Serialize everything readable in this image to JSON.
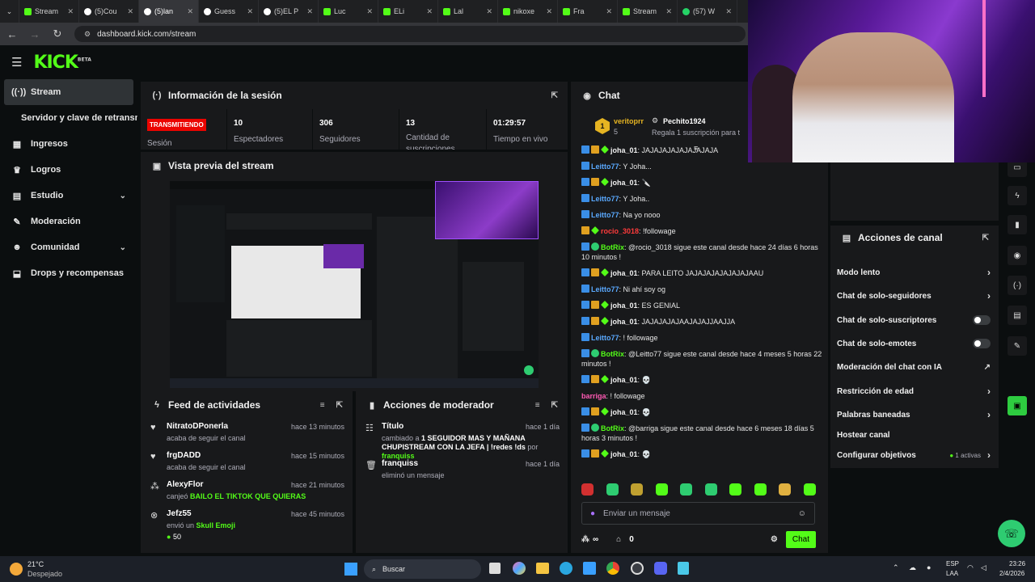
{
  "browser": {
    "tabs": [
      {
        "title": "Stream",
        "icon": "kick-favicon"
      },
      {
        "title": "(5)Cou",
        "icon": "tiktok-favicon"
      },
      {
        "title": "(5)lan",
        "icon": "tiktok-favicon",
        "active": true
      },
      {
        "title": "Guess",
        "icon": "tiktok-favicon"
      },
      {
        "title": "(5)EL P",
        "icon": "tiktok-favicon"
      },
      {
        "title": "Luc",
        "icon": "kick-favicon"
      },
      {
        "title": "ELi",
        "icon": "kick-favicon"
      },
      {
        "title": "Lal",
        "icon": "kick-favicon"
      },
      {
        "title": "nikoxe",
        "icon": "kick-favicon"
      },
      {
        "title": "Fra",
        "icon": "kick-favicon"
      },
      {
        "title": "Stream",
        "icon": "kick-favicon"
      },
      {
        "title": "(57) W",
        "icon": "whatsapp-favicon"
      }
    ],
    "url": "dashboard.kick.com/stream"
  },
  "header": {
    "logo": "KICK",
    "logo_tag": "BETA"
  },
  "sidebar": {
    "items": [
      {
        "label": "Stream",
        "icon": "broadcast-icon"
      },
      {
        "label": "Servidor y clave de retransm",
        "icon": ""
      },
      {
        "label": "Ingresos",
        "icon": "income-icon"
      },
      {
        "label": "Logros",
        "icon": "trophy-icon"
      },
      {
        "label": "Estudio",
        "icon": "studio-icon"
      },
      {
        "label": "Moderación",
        "icon": "wrench-icon"
      },
      {
        "label": "Comunidad",
        "icon": "community-icon"
      },
      {
        "label": "Drops y recompensas",
        "icon": "drops-icon"
      }
    ]
  },
  "session": {
    "title": "Información de la sesión",
    "status_badge": "TRANSMITIENDO",
    "status_label": "Sesión",
    "stats": [
      {
        "value": "10",
        "label": "Espectadores"
      },
      {
        "value": "306",
        "label": "Seguidores"
      },
      {
        "value": "13",
        "label": "Cantidad de suscripciones"
      },
      {
        "value": "01:29:57",
        "label": "Tiempo en vivo"
      }
    ]
  },
  "preview": {
    "title": "Vista previa del stream"
  },
  "feed": {
    "title": "Feed de actividades",
    "items": [
      {
        "name": "NitratoDPonerla",
        "desc": "acaba de seguir el canal",
        "time": "hace 13 minutos",
        "icon": "heart-icon"
      },
      {
        "name": "frgDADD",
        "desc": "acaba de seguir el canal",
        "time": "hace 15 minutos",
        "icon": "heart-icon"
      },
      {
        "name": "AlexyFlor",
        "desc_pre": "canjeó",
        "desc_hl": "BAILO EL TIKTOK QUE QUIERAS",
        "time": "hace 21 minutos",
        "icon": "redeem-icon"
      },
      {
        "name": "Jefz55",
        "desc_pre": "envió un",
        "desc_hl": "Skull Emoji",
        "amount": "50",
        "time": "hace 45 minutos",
        "icon": "kicks-icon"
      }
    ]
  },
  "mod_actions": {
    "title": "Acciones de moderador",
    "items": [
      {
        "name": "Título",
        "desc_pre": "cambiado a",
        "desc_hl": "1 SEGUIDOR MAS Y MAÑANA CHUPISTREAM CON LA JEFA | !redes !ds",
        "desc_post": "por",
        "by": "franquiss",
        "time": "hace 1 día"
      },
      {
        "name": "franquiss",
        "desc": "eliminó un mensaje",
        "time": "hace 1 día"
      }
    ]
  },
  "chat": {
    "title": "Chat",
    "pinned": {
      "rank": "1",
      "user": "veritoprr",
      "count": "5",
      "gifter": "Pechito1924",
      "gift_text": "Regala 1 suscripción para t"
    },
    "messages": [
      {
        "user": "joha_01",
        "color": "#f0f0f0",
        "text": "JAJAJAJAJAJAJAJAJA",
        "badges": [
          "b",
          "c",
          "g"
        ]
      },
      {
        "user": "Leitto77",
        "color": "#5aa9ff",
        "text": "Y Joha...",
        "badges": [
          "b"
        ]
      },
      {
        "user": "joha_01",
        "color": "#f0f0f0",
        "text": "🔪",
        "badges": [
          "b",
          "c",
          "g"
        ]
      },
      {
        "user": "Leitto77",
        "color": "#5aa9ff",
        "text": "Y Joha..",
        "badges": [
          "b"
        ]
      },
      {
        "user": "Leitto77",
        "color": "#5aa9ff",
        "text": "Na yo nooo",
        "badges": [
          "b"
        ]
      },
      {
        "user": "rocio_3018",
        "color": "#ff3b3b",
        "text": "!followage",
        "badges": [
          "c",
          "g"
        ]
      },
      {
        "user": "BotRix",
        "color": "#53fc18",
        "text": "@rocio_3018 sigue este canal desde hace 24 días 6 horas 10 minutos !",
        "badges": [
          "b",
          "v"
        ]
      },
      {
        "user": "joha_01",
        "color": "#f0f0f0",
        "text": "PARA LEITO JAJAJAJAJAJAJAJAAU",
        "badges": [
          "b",
          "c",
          "g"
        ]
      },
      {
        "user": "Leitto77",
        "color": "#5aa9ff",
        "text": "Ni ahí soy og",
        "badges": [
          "b"
        ]
      },
      {
        "user": "joha_01",
        "color": "#f0f0f0",
        "text": "ES GENIAL",
        "badges": [
          "b",
          "c",
          "g"
        ]
      },
      {
        "user": "joha_01",
        "color": "#f0f0f0",
        "text": "JAJAJAJAJAAJAJAJJAAJJA",
        "badges": [
          "b",
          "c",
          "g"
        ]
      },
      {
        "user": "Leitto77",
        "color": "#5aa9ff",
        "text": "! followage",
        "badges": [
          "b"
        ]
      },
      {
        "user": "BotRix",
        "color": "#53fc18",
        "text": "@Leitto77 sigue este canal desde hace 4 meses 5 horas 22 minutos !",
        "badges": [
          "b",
          "v"
        ]
      },
      {
        "user": "joha_01",
        "color": "#f0f0f0",
        "text": "💀",
        "badges": [
          "b",
          "c",
          "g"
        ]
      },
      {
        "user": "barriga",
        "color": "#ff5ab4",
        "text": "! followage",
        "badges": []
      },
      {
        "user": "joha_01",
        "color": "#f0f0f0",
        "text": "💀",
        "badges": [
          "b",
          "c",
          "g"
        ]
      },
      {
        "user": "BotRix",
        "color": "#53fc18",
        "text": "@barriga sigue este canal desde hace 6 meses 18 días 5 horas 3 minutos !",
        "badges": [
          "b",
          "v"
        ]
      },
      {
        "user": "joha_01",
        "color": "#f0f0f0",
        "text": "💀",
        "badges": [
          "b",
          "c",
          "g"
        ]
      }
    ],
    "input_placeholder": "Enviar un mensaje",
    "points": "∞",
    "gifts": "0",
    "send_label": "Chat"
  },
  "channel_actions": {
    "title": "Acciones de canal",
    "rows": [
      {
        "label": "Modo lento",
        "control": "chevron"
      },
      {
        "label": "Chat de solo-seguidores",
        "control": "chevron"
      },
      {
        "label": "Chat de solo-suscriptores",
        "control": "toggle"
      },
      {
        "label": "Chat de solo-emotes",
        "control": "toggle"
      },
      {
        "label": "Moderación del chat con IA",
        "control": "external"
      },
      {
        "label": "Restricción de edad",
        "control": "chevron"
      },
      {
        "label": "Palabras baneadas",
        "control": "chevron"
      },
      {
        "label": "Hostear canal",
        "control": "none"
      },
      {
        "label": "Configurar objetivos",
        "control": "chevron",
        "extra": "1 activas"
      }
    ]
  },
  "taskbar": {
    "weather_temp": "21°C",
    "weather_desc": "Despejado",
    "search_placeholder": "Buscar",
    "lang_top": "ESP",
    "lang_bottom": "LAA",
    "time": "23:26",
    "date": "2/4/2026"
  },
  "colors": {
    "accent": "#53fc18",
    "live": "#eb0400",
    "panel": "#18191b",
    "bg": "#0b0e0f"
  }
}
